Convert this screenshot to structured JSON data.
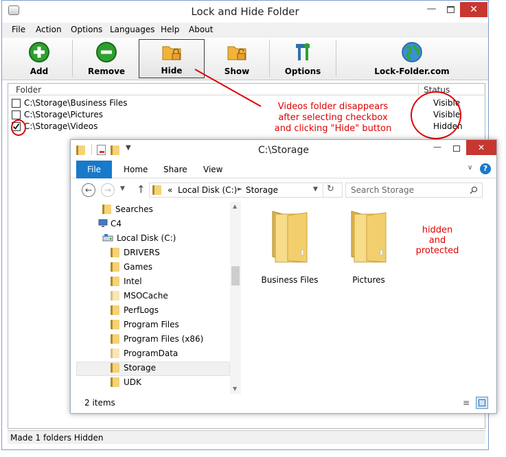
{
  "app": {
    "title": "Lock and Hide Folder",
    "menu": [
      "File",
      "Action",
      "Options",
      "Languages",
      "Help",
      "About"
    ],
    "toolbar": [
      "Add",
      "Remove",
      "Hide",
      "Show",
      "Options",
      "Lock-Folder.com"
    ],
    "columns": {
      "folder": "Folder",
      "status": "Status"
    },
    "rows": [
      {
        "path": "C:\\Storage\\Business Files",
        "status": "Visible",
        "checked": false
      },
      {
        "path": "C:\\Storage\\Pictures",
        "status": "Visible",
        "checked": false
      },
      {
        "path": "C:\\Storage\\Videos",
        "status": "Hidden",
        "checked": true
      }
    ],
    "statusbar": "Made  1  folders Hidden"
  },
  "annotations": {
    "callout": [
      "Videos folder disappears",
      "after selecting checkbox",
      "and clicking \"Hide\" button"
    ],
    "hidden_note": [
      "hidden",
      "and",
      "protected"
    ]
  },
  "explorer": {
    "title": "C:\\Storage",
    "ribbon_tabs": [
      "File",
      "Home",
      "Share",
      "View"
    ],
    "address": {
      "prefix": "«",
      "parts": [
        "Local Disk (C:)",
        "Storage"
      ]
    },
    "search_placeholder": "Search Storage",
    "nav": [
      {
        "label": "Searches"
      },
      {
        "label": "C4"
      },
      {
        "label": "Local Disk (C:)"
      },
      {
        "label": "DRIVERS"
      },
      {
        "label": "Games"
      },
      {
        "label": "Intel"
      },
      {
        "label": "MSOCache"
      },
      {
        "label": "PerfLogs"
      },
      {
        "label": "Program Files"
      },
      {
        "label": "Program Files (x86)"
      },
      {
        "label": "ProgramData"
      },
      {
        "label": "Storage"
      },
      {
        "label": "UDK"
      }
    ],
    "items": [
      "Business Files",
      "Pictures"
    ],
    "status": "2 items"
  },
  "colors": {
    "accent_blue": "#1979ca",
    "annotation_red": "#e00000",
    "close_red": "#c7372f"
  }
}
